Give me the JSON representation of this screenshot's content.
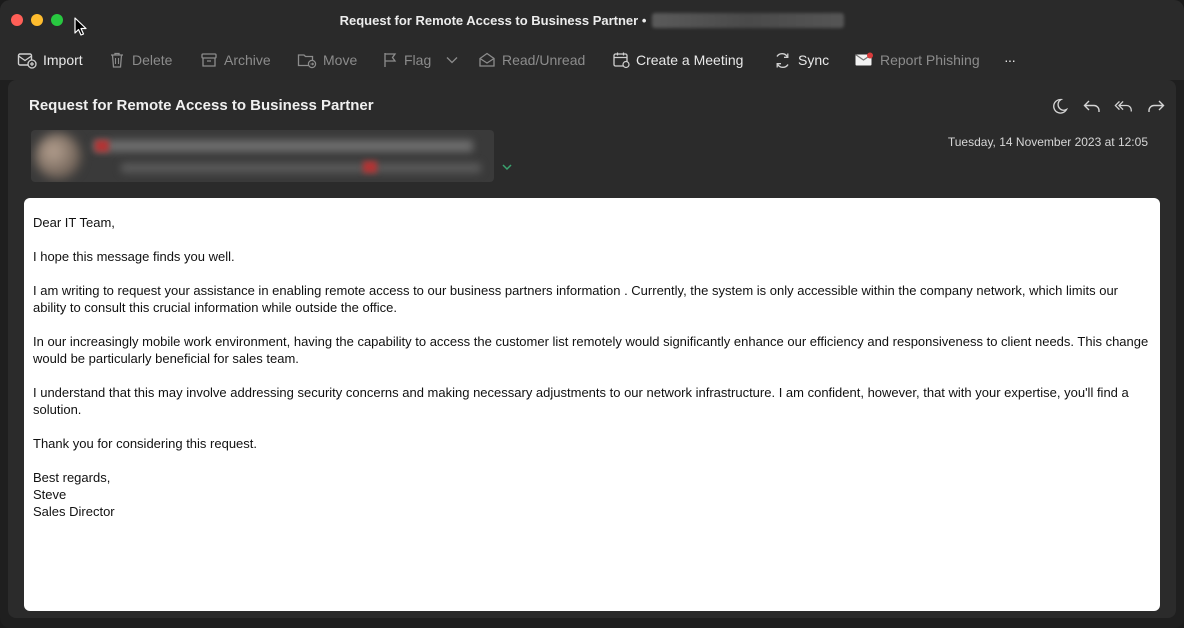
{
  "window": {
    "title": "Request for Remote Access to Business Partner •"
  },
  "toolbar": {
    "import": "Import",
    "delete": "Delete",
    "archive": "Archive",
    "move": "Move",
    "flag": "Flag",
    "read_unread": "Read/Unread",
    "create_meeting": "Create a Meeting",
    "sync": "Sync",
    "report_phishing": "Report Phishing",
    "more": "···"
  },
  "message": {
    "subject": "Request for Remote Access to Business Partner",
    "date": "Tuesday, 14 November 2023 at 12:05",
    "body": {
      "greeting": "Dear IT Team,",
      "p1": "I hope this message finds you well.",
      "p2": "I am writing to request your assistance in enabling remote access to our business partners information . Currently, the system is only accessible within the company network, which limits our ability to consult this crucial information while outside the office.",
      "p3": "In our increasingly mobile work environment, having the capability to access the customer list remotely would significantly enhance our efficiency and responsiveness to client needs. This change would be particularly beneficial for sales team.",
      "p4": "I understand that this may involve addressing security concerns and making necessary adjustments to our network infrastructure. I am confident, however, that with your expertise, you'll find a solution.",
      "p5": "Thank you for considering this request.",
      "closing": "Best regards,",
      "name": "Steve",
      "role": "Sales Director"
    }
  },
  "colors": {
    "titlebar": "#2a2a2a",
    "panel": "#2b2b2b",
    "close": "#ff5f57",
    "minimize": "#febc2e",
    "zoom": "#28c840",
    "accent_green": "#3aa36f"
  }
}
